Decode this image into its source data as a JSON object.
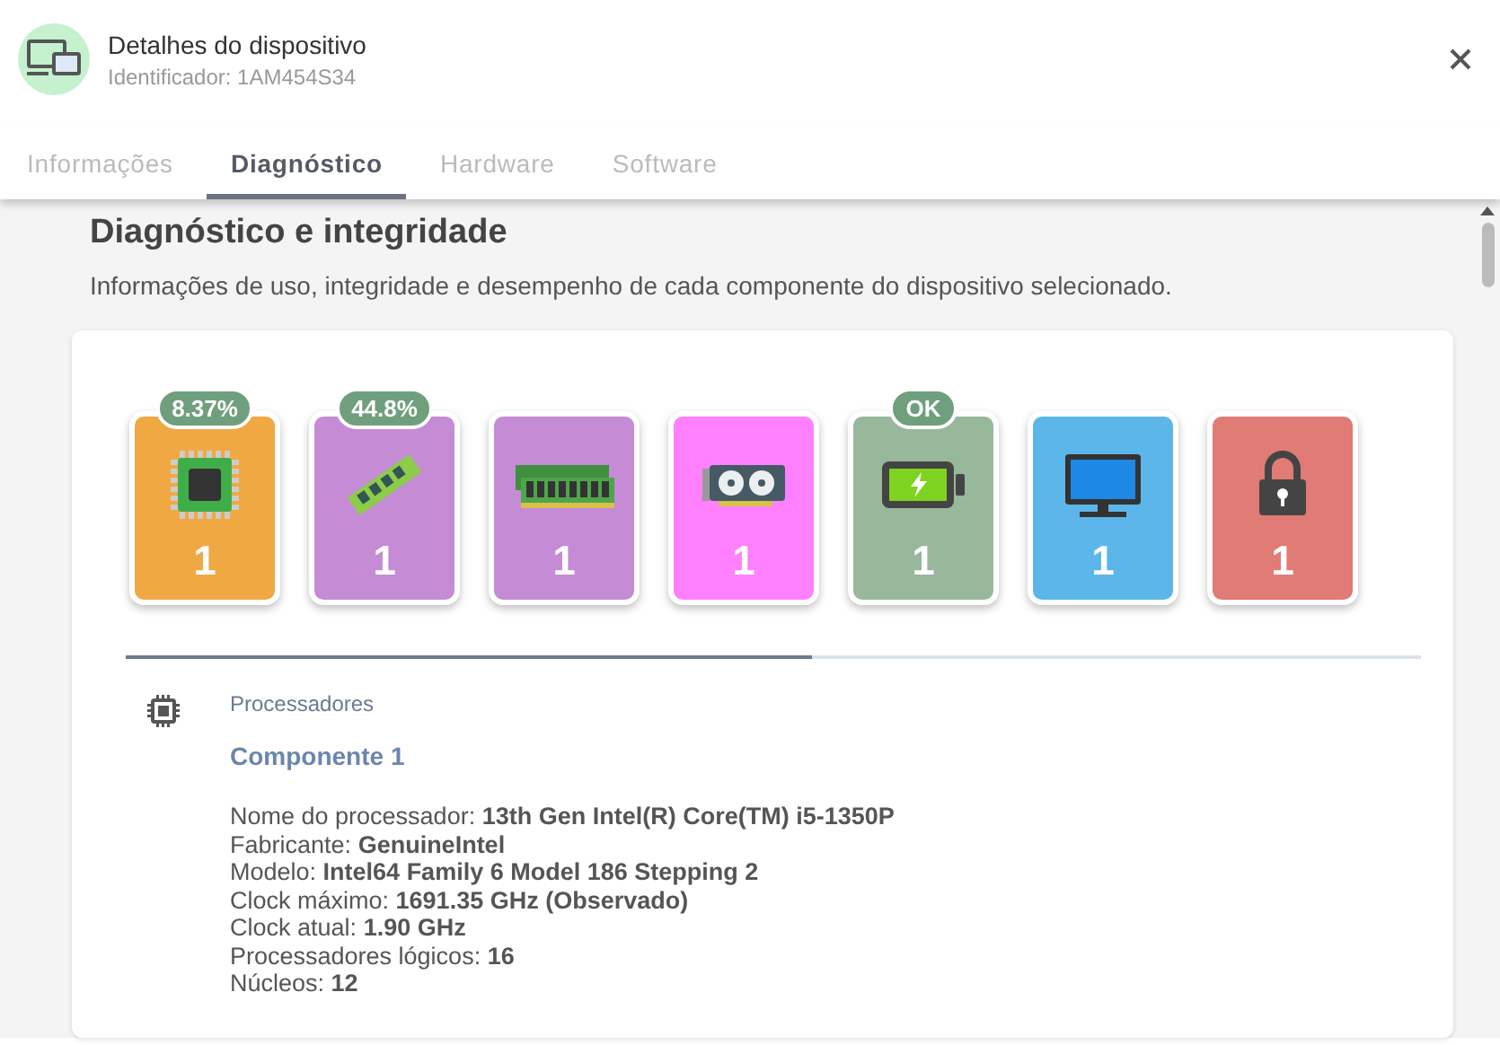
{
  "header": {
    "title": "Detalhes do dispositivo",
    "subtitle": "Identificador: 1AM454S34"
  },
  "tabs": [
    {
      "label": "Informações",
      "selected": false
    },
    {
      "label": "Diagnóstico",
      "selected": true
    },
    {
      "label": "Hardware",
      "selected": false
    },
    {
      "label": "Software",
      "selected": false
    }
  ],
  "section": {
    "title": "Diagnóstico e integridade",
    "description": "Informações de uso, integridade e desempenho de cada componente do dispositivo selecionado."
  },
  "component_cards": [
    {
      "kind": "cpu",
      "color": "#f0a843",
      "badge": "8.37%",
      "count": "1"
    },
    {
      "kind": "ram",
      "color": "#c58bd5",
      "badge": "44.8%",
      "count": "1"
    },
    {
      "kind": "ram-pair",
      "color": "#c58bd5",
      "count": "1"
    },
    {
      "kind": "gpu",
      "color": "#ff80ff",
      "count": "1"
    },
    {
      "kind": "battery",
      "color": "#98b89b",
      "badge": "OK",
      "count": "1"
    },
    {
      "kind": "monitor",
      "color": "#5cb6ea",
      "count": "1"
    },
    {
      "kind": "lock",
      "color": "#e07b76",
      "count": "1"
    }
  ],
  "carousel_progress": {
    "level": 0.53
  },
  "details": {
    "category": "Processadores",
    "component": "Componente 1",
    "properties": [
      {
        "label": "Nome do processador:",
        "value": "13th Gen Intel(R) Core(TM) i5-1350P"
      },
      {
        "label": "Fabricante:",
        "value": "GenuineIntel"
      },
      {
        "label": "Modelo:",
        "value": "Intel64 Family 6 Model 186 Stepping 2"
      },
      {
        "label": "Clock máximo:",
        "value": "1691.35 GHz (Observado)"
      },
      {
        "label": "Clock atual:",
        "value": "1.90 GHz"
      },
      {
        "label": "Processadores lógicos:",
        "value": "16"
      },
      {
        "label": "Núcleos:",
        "value": "12"
      }
    ]
  }
}
